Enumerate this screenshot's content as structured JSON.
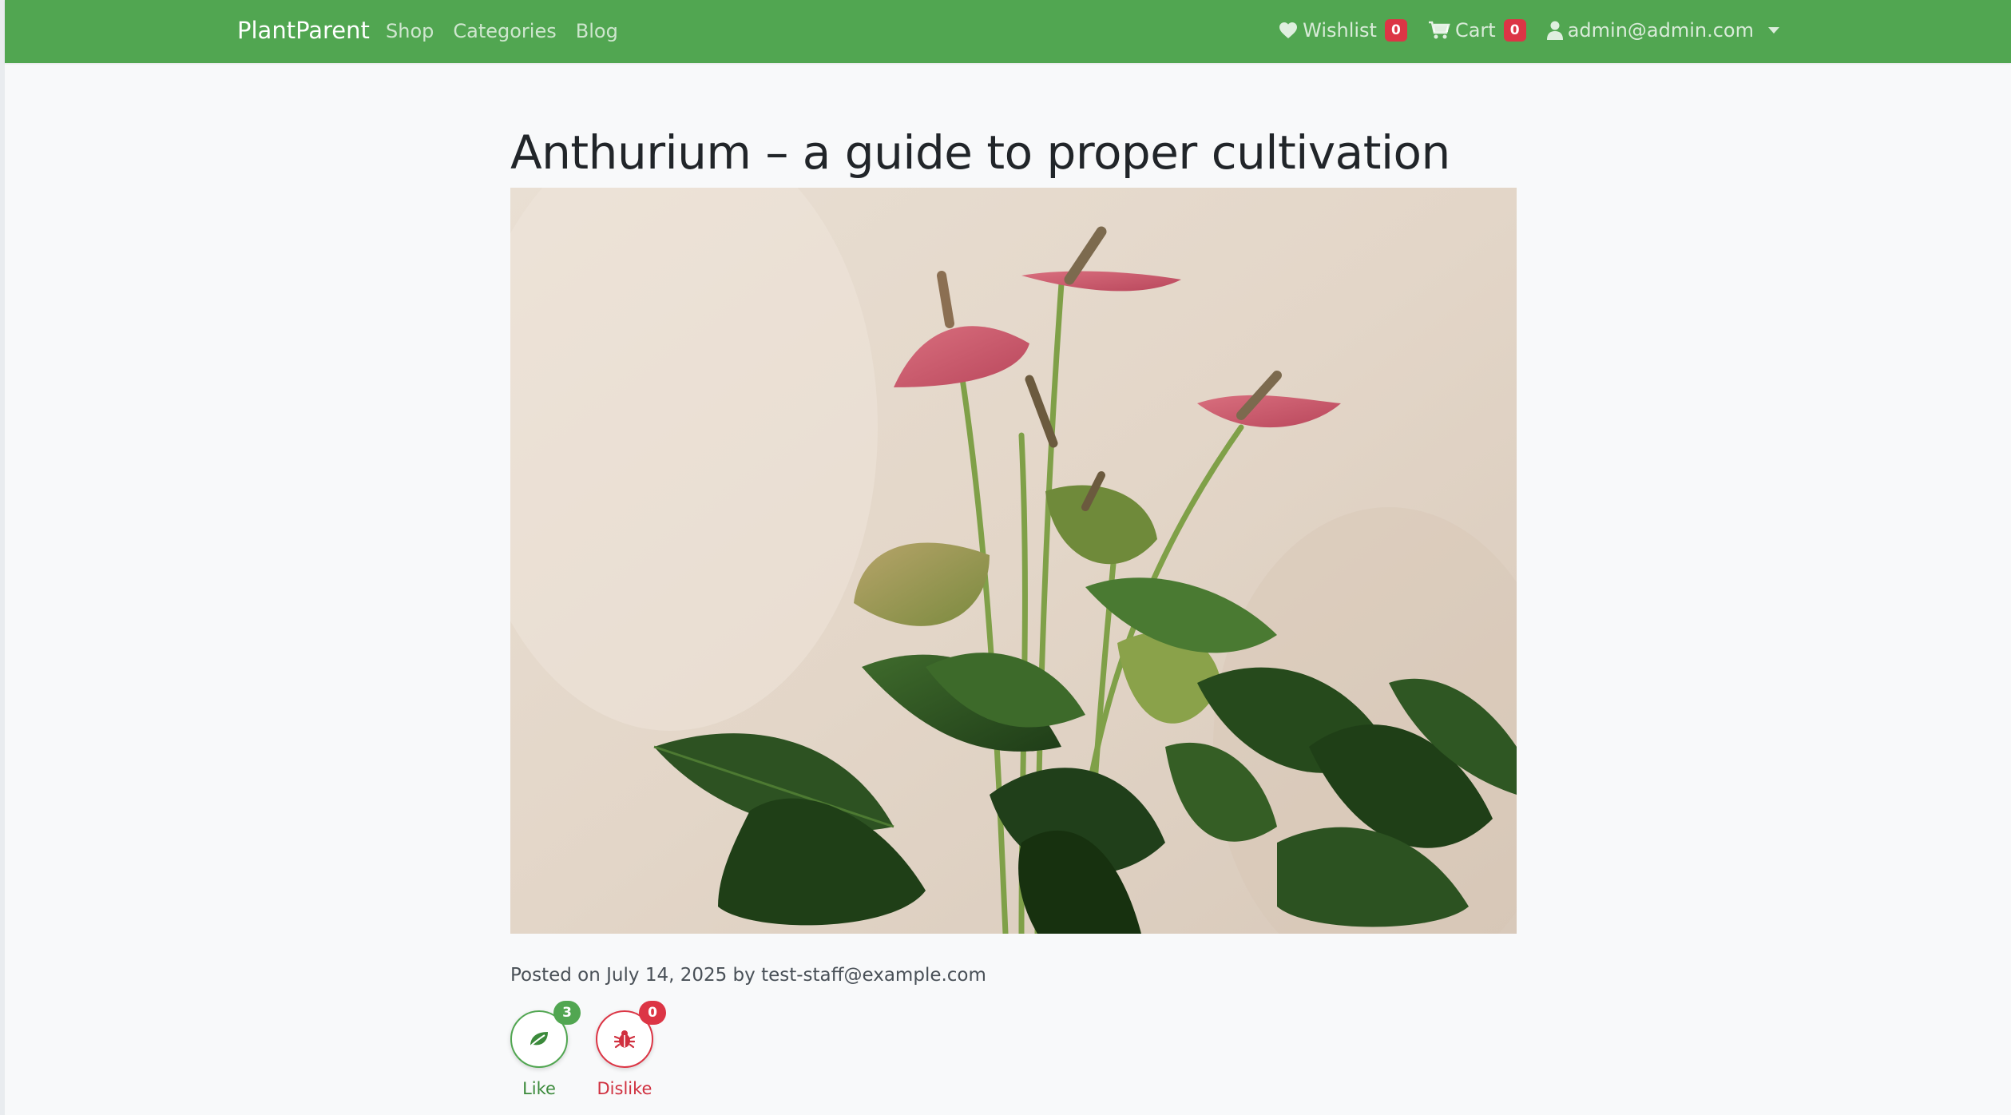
{
  "navbar": {
    "brand": "PlantParent",
    "links": [
      "Shop",
      "Categories",
      "Blog"
    ],
    "wishlist": {
      "label": "Wishlist",
      "count": "0",
      "icon": "heart-icon"
    },
    "cart": {
      "label": "Cart",
      "count": "0",
      "icon": "cart-icon"
    },
    "user": {
      "label": "admin@admin.com",
      "icon": "user-icon"
    },
    "colors": {
      "background": "#51a651",
      "badge": "#dc3545"
    }
  },
  "post": {
    "title": "Anthurium – a guide to proper cultivation",
    "meta": "Posted on July 14, 2025 by test-staff@example.com",
    "image": "anthurium-plant-photo"
  },
  "reactions": {
    "like": {
      "label": "Like",
      "count": "3",
      "icon": "leaf-icon",
      "color": "#51a651"
    },
    "dislike": {
      "label": "Dislike",
      "count": "0",
      "icon": "bug-icon",
      "color": "#dc3545"
    }
  }
}
